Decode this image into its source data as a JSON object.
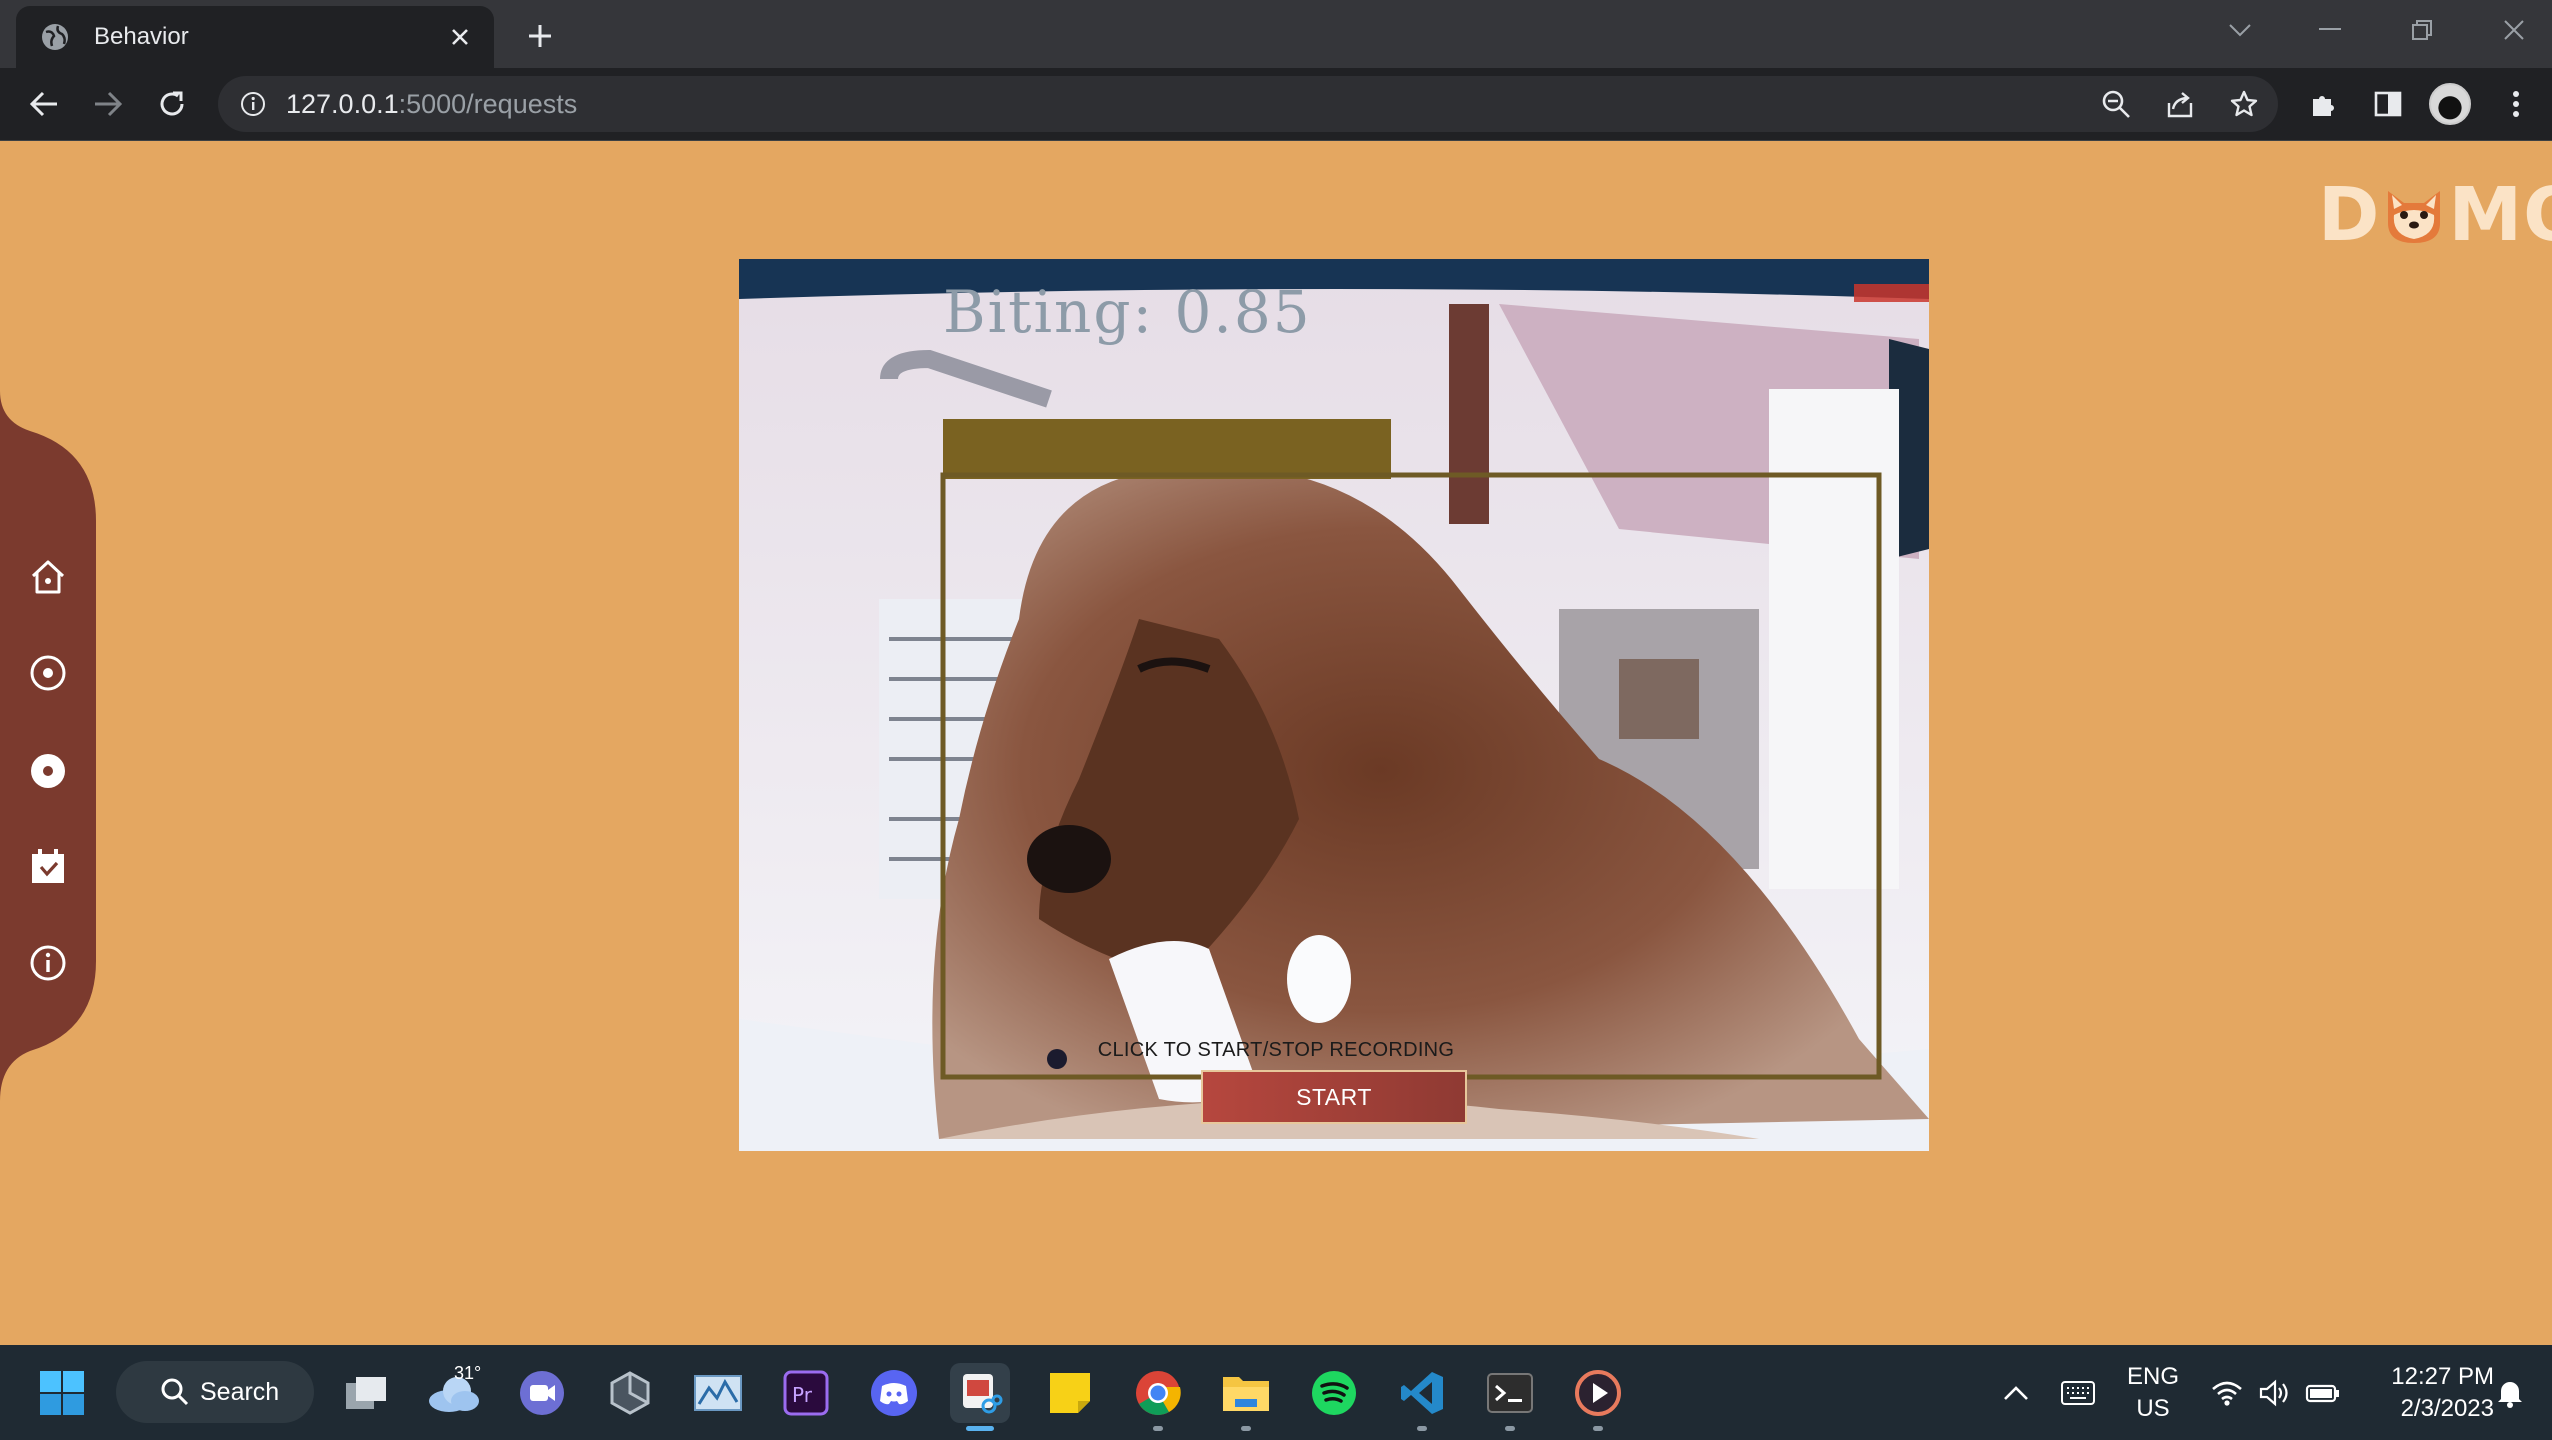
{
  "browser": {
    "tab_title": "Behavior",
    "url_host": "127.0.0.1",
    "url_path": ":5000/requests"
  },
  "page": {
    "logo_left": "D",
    "logo_right": "MO",
    "sidebar": [
      {
        "name": "home-icon"
      },
      {
        "name": "record-outline-icon"
      },
      {
        "name": "record-filled-icon"
      },
      {
        "name": "calendar-icon"
      },
      {
        "name": "info-icon"
      }
    ],
    "detection_label": "Biting: 0.85",
    "recording_caption": "CLICK TO START/STOP RECORDING",
    "start_button": "START",
    "colors": {
      "background": "#e4a761",
      "sidebar": "#7b3a2e",
      "button": "#b6473e",
      "bbox": "#6e5a25"
    }
  },
  "taskbar": {
    "search_label": "Search",
    "weather_temp": "31°",
    "language_line1": "ENG",
    "language_line2": "US",
    "time": "12:27 PM",
    "date": "2/3/2023"
  }
}
